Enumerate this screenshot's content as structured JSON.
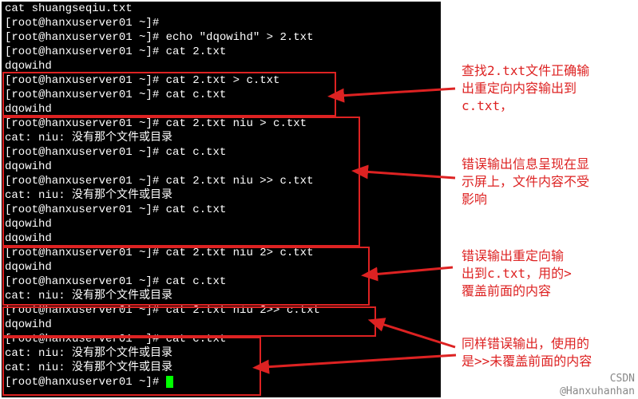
{
  "terminal": {
    "line1": "cat shuangseqiu.txt",
    "line2_prompt": "[root@hanxuserver01 ~]#",
    "line3_prompt": "[root@hanxuserver01 ~]#",
    "line3_cmd": " echo \"dqowihd\" > 2.txt",
    "line4_prompt": "[root@hanxuserver01 ~]#",
    "line4_cmd": " cat 2.txt",
    "line5_out": "dqowihd",
    "line6_prompt": "[root@hanxuserver01 ~]#",
    "line6_cmd": " cat 2.txt > c.txt",
    "line7_prompt": "[root@hanxuserver01 ~]#",
    "line7_cmd": " cat c.txt",
    "line8_out": "dqowihd",
    "line9_prompt": "[root@hanxuserver01 ~]#",
    "line9_cmd": " cat 2.txt niu > c.txt",
    "line10_out": "cat: niu: 没有那个文件或目录",
    "line11_prompt": "[root@hanxuserver01 ~]#",
    "line11_cmd": " cat c.txt",
    "line12_out": "dqowihd",
    "line13_prompt": "[root@hanxuserver01 ~]#",
    "line13_cmd": " cat 2.txt niu >> c.txt",
    "line14_out": "cat: niu: 没有那个文件或目录",
    "line15_prompt": "[root@hanxuserver01 ~]#",
    "line15_cmd": " cat c.txt",
    "line16_out": "dqowihd",
    "line17_out": "dqowihd",
    "line18_prompt": "[root@hanxuserver01 ~]#",
    "line18_cmd": " cat 2.txt niu 2> c.txt",
    "line19_out": "dqowihd",
    "line20_prompt": "[root@hanxuserver01 ~]#",
    "line20_cmd": " cat c.txt",
    "line21_out": "cat: niu: 没有那个文件或目录",
    "line22_prompt": "[root@hanxuserver01 ~]#",
    "line22_cmd": " cat 2.txt niu 2>> c.txt",
    "line23_out": "dqowihd",
    "line24_prompt": "[root@hanxuserver01 ~]#",
    "line24_cmd": " cat c.txt",
    "line25_out": "cat: niu: 没有那个文件或目录",
    "line26_out": "cat: niu: 没有那个文件或目录",
    "line27_prompt": "[root@hanxuserver01 ~]#"
  },
  "annotations": {
    "a1_l1": "查找2.txt文件正确输",
    "a1_l2": "出重定向内容输出到",
    "a1_l3": "c.txt，",
    "a2_l1": "错误输出信息呈现在显",
    "a2_l2": "示屏上，文件内容不受",
    "a2_l3": "影响",
    "a3_l1": "错误输出重定向输",
    "a3_l2": "出到c.txt，用的>",
    "a3_l3": "覆盖前面的内容",
    "a4_l1": "同样错误输出，使用的",
    "a4_l2": "是>>未覆盖前面的内容"
  },
  "watermark1": "@Hanxuhanhan",
  "watermark2": "CSDN"
}
